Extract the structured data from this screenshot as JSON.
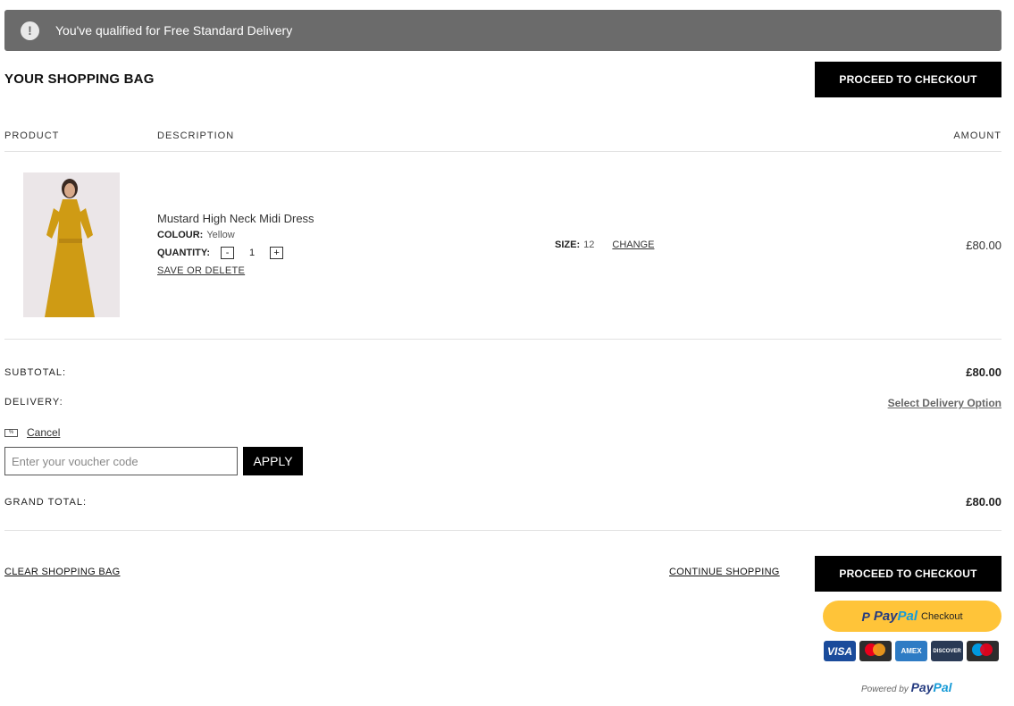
{
  "banner": {
    "message": "You've qualified for Free Standard Delivery"
  },
  "bag": {
    "title": "YOUR SHOPPING BAG"
  },
  "checkout_label": "PROCEED TO CHECKOUT",
  "columns": {
    "product": "PRODUCT",
    "description": "DESCRIPTION",
    "amount": "AMOUNT"
  },
  "item": {
    "name": "Mustard High Neck Midi Dress",
    "colour_label": "COLOUR:",
    "colour": "Yellow",
    "quantity_label": "QUANTITY:",
    "quantity": "1",
    "minus": "-",
    "plus": "+",
    "save_delete": "SAVE OR DELETE",
    "size_label": "SIZE:",
    "size": "12",
    "change": "CHANGE",
    "amount": "£80.00",
    "image_icon": "product-photo-yellow-dress"
  },
  "summary": {
    "subtotal_label": "SUBTOTAL:",
    "subtotal": "£80.00",
    "delivery_label": "DELIVERY:",
    "delivery_option": "Select Delivery Option",
    "cancel": "Cancel",
    "voucher_placeholder": "Enter your voucher code",
    "apply": "APPLY",
    "grand_total_label": "GRAND TOTAL:",
    "grand_total": "£80.00"
  },
  "footer": {
    "clear_bag": "CLEAR SHOPPING BAG",
    "continue": "CONTINUE SHOPPING"
  },
  "paypal": {
    "pay": "Pay",
    "pal": "Pal",
    "checkout": "Checkout",
    "powered_by": "Powered by"
  },
  "cards": {
    "visa": "VISA",
    "amex": "AMEX",
    "discover": "DISCOVER"
  },
  "colors": {
    "accent": "#000000",
    "banner": "#6b6b6b",
    "paypal_yellow": "#ffc439"
  }
}
